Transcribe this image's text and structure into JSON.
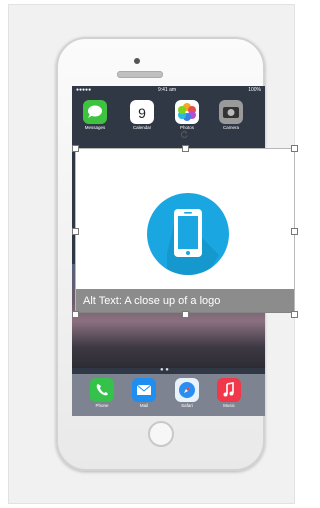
{
  "status_bar": {
    "carrier": "●●●●●",
    "time": "9:41 am",
    "battery": "100%"
  },
  "home_apps": [
    {
      "label": "Messages",
      "icon": "messages-icon"
    },
    {
      "label": "Calendar",
      "icon": "calendar-icon",
      "badge_text": "9"
    },
    {
      "label": "Photos",
      "icon": "photos-icon"
    },
    {
      "label": "Camera",
      "icon": "camera-icon"
    }
  ],
  "dock_apps": [
    {
      "label": "Phone",
      "icon": "phone-icon"
    },
    {
      "label": "Mail",
      "icon": "mail-icon"
    },
    {
      "label": "Safari",
      "icon": "safari-icon"
    },
    {
      "label": "Music",
      "icon": "music-icon"
    }
  ],
  "picture": {
    "alt_text": "Alt Text: A close  up of a logo",
    "logo_color": "#1aa6e0"
  }
}
